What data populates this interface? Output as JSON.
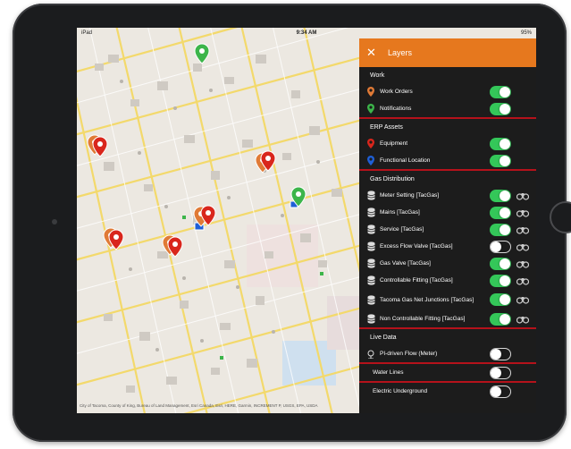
{
  "status_bar": {
    "left": "iPad",
    "time": "9:34 AM",
    "right": "95%"
  },
  "map": {
    "attribution": "City of Tacoma, County of King, Bureau of Land Management, Esri Canada, Esri, HERE, Garmin, INCREMENT P, USGS, EPA, USDA",
    "powered_by": "Powered by Esri"
  },
  "panel": {
    "title": "Layers",
    "sections": {
      "work": {
        "title": "Work",
        "work_orders": "Work Orders",
        "notifications": "Notifications"
      },
      "erp": {
        "title": "ERP Assets",
        "equipment": "Equipment",
        "functional_location": "Functional Location"
      },
      "gas": {
        "title": "Gas Distribution",
        "meter_setting": "Meter Setting [TacGas]",
        "mains": "Mains [TacGas]",
        "service": "Service [TacGas]",
        "excess_flow_valve": "Excess Flow Valve [TacGas]",
        "gas_valve": "Gas Valve [TacGas]",
        "controllable_fitting": "Controllable Fitting [TacGas]",
        "net_junctions": "Tacoma Gas Net Junctions [TacGas]",
        "non_controllable_fitting": "Non Controllable Fitting [TacGas]"
      },
      "live": {
        "title": "Live Data",
        "pi_flow": "PI-driven Flow (Meter)"
      },
      "water": {
        "title": "Water Lines"
      },
      "electric": {
        "title": "Electric Underground"
      }
    }
  },
  "colors": {
    "header": "#e6781e",
    "divider": "#b5121b",
    "toggle_on": "#34c759",
    "pin_red": "#d9261c",
    "pin_orange": "#e07a36",
    "pin_green": "#3cb54a",
    "pin_blue": "#1f5fd6"
  },
  "icons": {
    "close": "close-icon",
    "work_order": "map-pin-icon",
    "database": "database-icon",
    "live": "sensor-icon",
    "binoculars": "binoculars-icon"
  }
}
